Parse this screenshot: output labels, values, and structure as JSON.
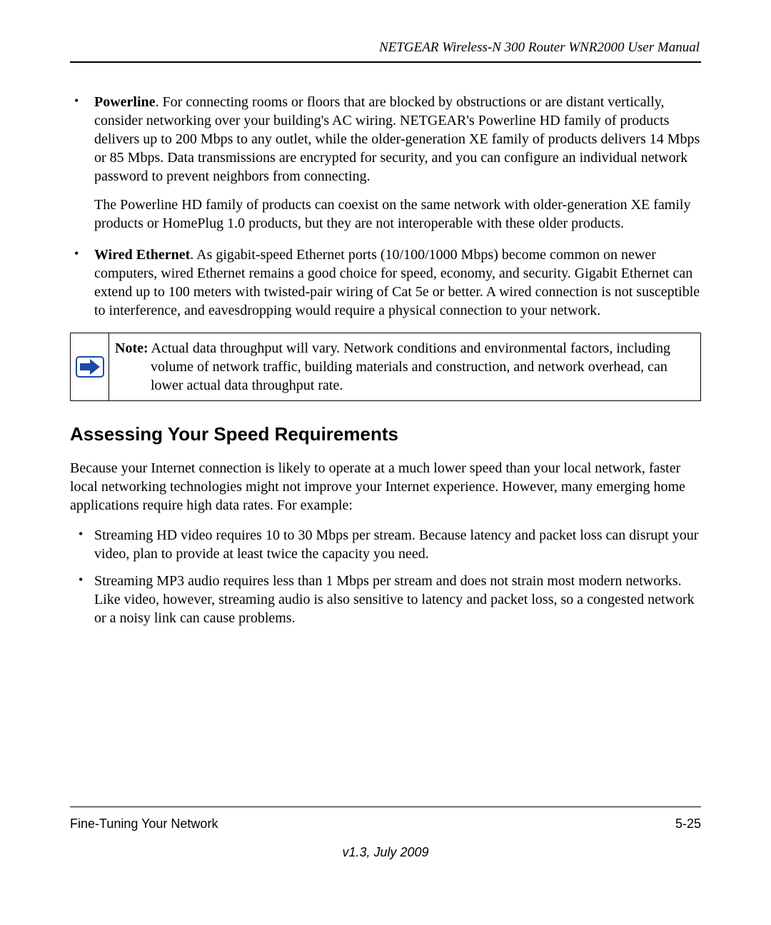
{
  "header": {
    "running_title": "NETGEAR Wireless-N 300 Router WNR2000 User Manual"
  },
  "bullets_top": [
    {
      "lead": "Powerline",
      "text1": ". For connecting rooms or floors that are blocked by obstructions or are distant vertically, consider networking over your building's AC wiring. NETGEAR's Powerline HD family of products delivers up to 200 Mbps to any outlet, while the older-generation XE family of products delivers 14 Mbps or 85 Mbps. Data transmissions are encrypted for security, and you can configure an individual network password to prevent neighbors from connecting.",
      "text2": "The Powerline HD family of products can coexist on the same network with older-generation XE family products or HomePlug 1.0 products, but they are not interoperable with these older products."
    },
    {
      "lead": "Wired Ethernet",
      "text1": ". As gigabit-speed Ethernet ports (10/100/1000 Mbps) become common on newer computers, wired Ethernet remains a good choice for speed, economy, and security. Gigabit Ethernet can extend up to 100 meters with twisted-pair wiring of Cat 5e or better. A wired connection is not susceptible to interference, and eavesdropping would require a physical connection to your network."
    }
  ],
  "note": {
    "label": "Note:",
    "text": " Actual data throughput will vary. Network conditions and environmental factors, including volume of network traffic, building materials and construction, and network overhead, can lower actual data throughput rate."
  },
  "section_heading": "Assessing Your Speed Requirements",
  "intro_para": "Because your Internet connection is likely to operate at a much lower speed than your local network, faster local networking technologies might not improve your Internet experience. However, many emerging home applications require high data rates. For example:",
  "bullets_lower": [
    "Streaming HD video requires 10 to 30 Mbps per stream. Because latency and packet loss can disrupt your video, plan to provide at least twice the capacity you need.",
    "Streaming MP3 audio requires less than 1 Mbps per stream and does not strain most modern networks. Like video, however, streaming audio is also sensitive to latency and packet loss, so a congested network or a noisy link can cause problems."
  ],
  "footer": {
    "section": "Fine-Tuning Your Network",
    "page": "5-25",
    "version": "v1.3, July 2009"
  }
}
